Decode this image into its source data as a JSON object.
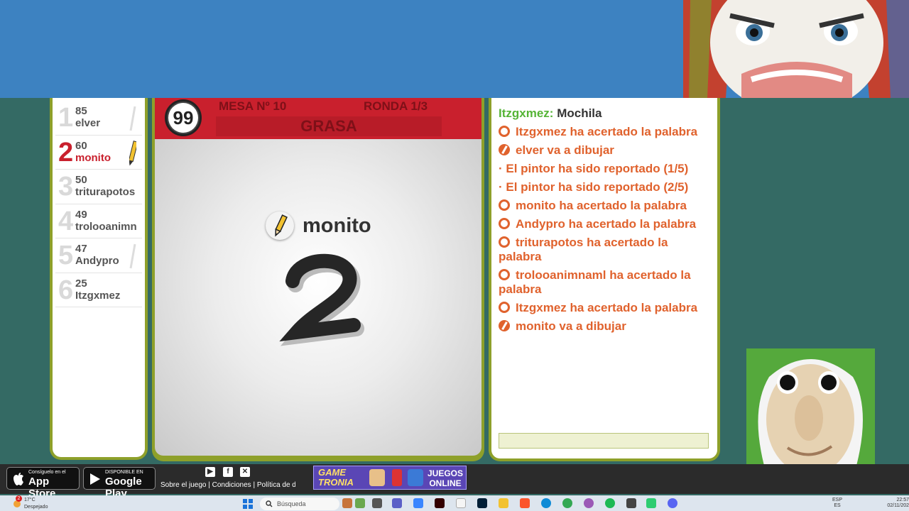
{
  "players": [
    {
      "rank": "1",
      "score": "85",
      "name": "elver",
      "drawing": false,
      "drawn": true
    },
    {
      "rank": "2",
      "score": "60",
      "name": "monito",
      "drawing": true,
      "drawn": false
    },
    {
      "rank": "3",
      "score": "50",
      "name": "triturapotos",
      "drawing": false,
      "drawn": false
    },
    {
      "rank": "4",
      "score": "49",
      "name": "trolooanimn",
      "drawing": false,
      "drawn": false
    },
    {
      "rank": "5",
      "score": "47",
      "name": "Andypro",
      "drawing": false,
      "drawn": true
    },
    {
      "rank": "6",
      "score": "25",
      "name": "Itzgxmez",
      "drawing": false,
      "drawn": false
    }
  ],
  "board": {
    "timer": "99",
    "mesa": "MESA Nº 10",
    "ronda": "RONDA 1/3",
    "word": "GRASA",
    "drawer": "monito",
    "countdown": "2"
  },
  "chat": {
    "messages": [
      {
        "type": "said",
        "user": "Itzgxmez:",
        "text": "Mochila"
      },
      {
        "type": "star",
        "text": "Itzgxmez ha acertado la palabra"
      },
      {
        "type": "pen",
        "text": "elver va a dibujar"
      },
      {
        "type": "dot",
        "text": "· El pintor ha sido reportado (1/5)"
      },
      {
        "type": "dot",
        "text": "· El pintor ha sido reportado (2/5)"
      },
      {
        "type": "star",
        "text": "monito ha acertado la palabra"
      },
      {
        "type": "star",
        "text": "Andypro ha acertado la palabra"
      },
      {
        "type": "star",
        "text": "triturapotos ha acertado la palabra"
      },
      {
        "type": "star",
        "text": "trolooanimnaml ha acertado la palabra"
      },
      {
        "type": "star",
        "text": "Itzgxmez ha acertado la palabra"
      },
      {
        "type": "pen",
        "text": "monito va a dibujar"
      }
    ],
    "input_value": ""
  },
  "footer": {
    "appstore_small": "Consíguelo en el",
    "appstore_big": "App Store",
    "googleplay_small": "DISPONIBLE EN",
    "googleplay_big": "Google Play",
    "links": "Sobre el juego | Condiciones | Política de dat",
    "banner_logo_1": "GAME",
    "banner_logo_2": "TRONIA",
    "banner_text_1": "JUEGOS",
    "banner_text_2": "ONLINE"
  },
  "taskbar": {
    "weather_badge": "2",
    "temp": "17°C",
    "condition": "Despejado",
    "search_placeholder": "Búsqueda",
    "lang_1": "ESP",
    "lang_2": "ES",
    "time": "22:57",
    "date": "02/11/202"
  },
  "colors": {
    "page_bg": "#346a64",
    "banner_blue": "#3d82c1",
    "panel_border": "#8ea02a",
    "header_red": "#c9202d",
    "chat_system": "#e0622d",
    "chat_user": "#55b436"
  }
}
